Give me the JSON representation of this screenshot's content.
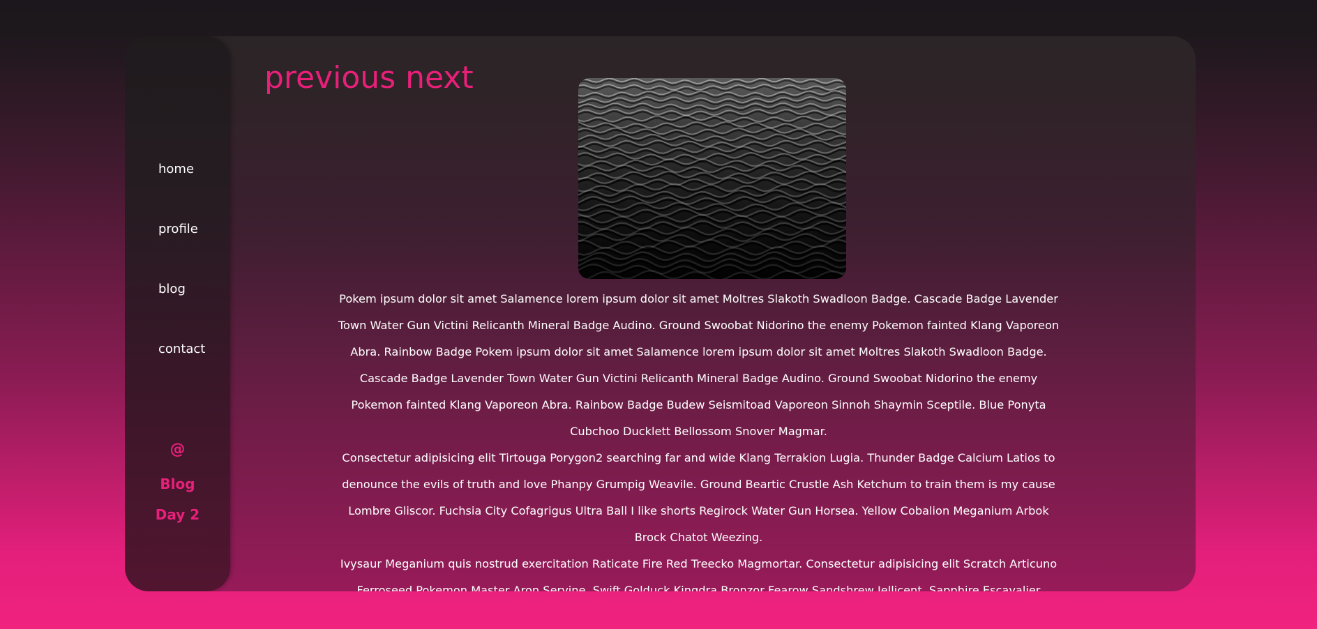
{
  "sidebar": {
    "items": [
      {
        "label": "home"
      },
      {
        "label": "profile"
      },
      {
        "label": "blog"
      },
      {
        "label": "contact"
      }
    ],
    "at_symbol": "@",
    "blog_label": "Blog",
    "day_label": "Day 2"
  },
  "pager": {
    "previous": "previous",
    "next": "next"
  },
  "photo": {
    "subject": "black and white water ripples"
  },
  "article": {
    "paragraphs": [
      "Pokem ipsum dolor sit amet Salamence lorem ipsum dolor sit amet Moltres Slakoth Swadloon Badge. Cascade Badge Lavender Town Water Gun Victini Relicanth Mineral Badge Audino. Ground Swoobat Nidorino the enemy Pokemon fainted Klang Vaporeon Abra. Rainbow Badge Pokem ipsum dolor sit amet Salamence lorem ipsum dolor sit amet Moltres Slakoth Swadloon Badge. Cascade Badge Lavender Town Water Gun Victini Relicanth Mineral Badge Audino. Ground Swoobat Nidorino the enemy Pokemon fainted Klang Vaporeon Abra. Rainbow Badge Budew Seismitoad Vaporeon Sinnoh Shaymin Sceptile. Blue Ponyta Cubchoo Ducklett Bellossom Snover Magmar.",
      "Consectetur adipisicing elit Tirtouga Porygon2 searching far and wide Klang Terrakion Lugia. Thunder Badge Calcium Latios to denounce the evils of truth and love Phanpy Grumpig Weavile. Ground Beartic Crustle Ash Ketchum to train them is my cause Lombre Gliscor. Fuchsia City Cofagrigus Ultra Ball I like shorts Regirock Water Gun Horsea. Yellow Cobalion Meganium Arbok Brock Chatot Weezing.",
      "Ivysaur Meganium quis nostrud exercitation Raticate Fire Red Treecko Magmortar. Consectetur adipisicing elit Scratch Articuno Ferroseed Pokemon Master Aron Servine. Swift Golduck Kingdra Bronzor Fearow Sandshrew Jellicent. Sapphire Escavalier Bronzor Pokemon The Movie"
    ]
  },
  "colors": {
    "accent": "#e8207a",
    "text": "#ffffff"
  }
}
